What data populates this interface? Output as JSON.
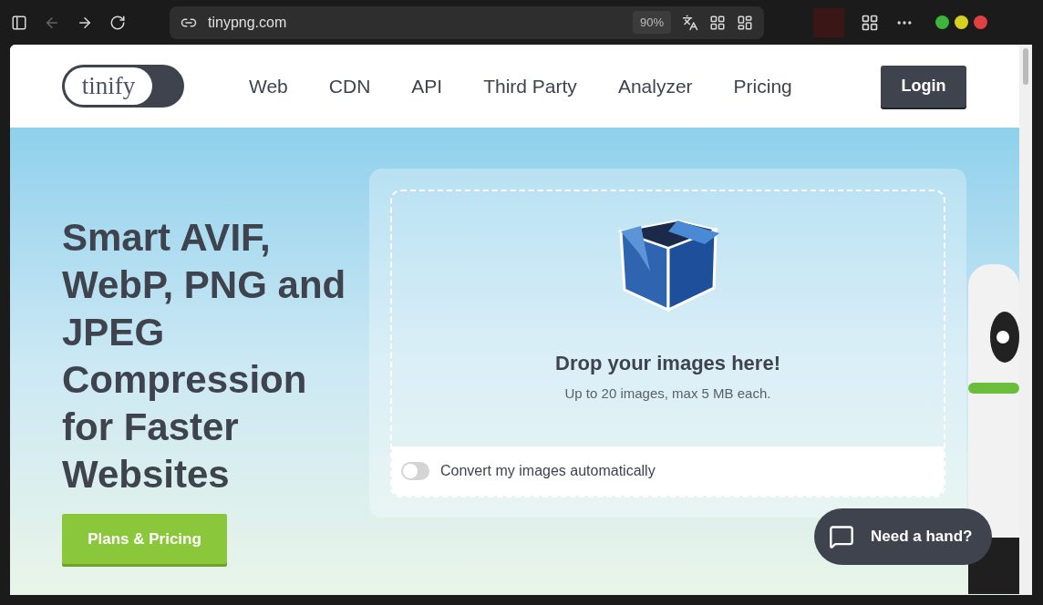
{
  "browser": {
    "url": "tinypng.com",
    "zoom": "90%"
  },
  "nav": {
    "logo": "tinify",
    "links": [
      {
        "label": "Web"
      },
      {
        "label": "CDN"
      },
      {
        "label": "API"
      },
      {
        "label": "Third Party"
      },
      {
        "label": "Analyzer"
      },
      {
        "label": "Pricing"
      }
    ],
    "login": "Login"
  },
  "hero": {
    "title": "Smart AVIF, WebP, PNG and JPEG Compression for Faster Websites",
    "button": "Plans & Pricing"
  },
  "dropzone": {
    "title": "Drop your images here!",
    "subtitle": "Up to 20 images, max 5 MB each.",
    "toggle": {
      "label": "Convert my images automatically",
      "on": false
    }
  },
  "help": {
    "label": "Need a hand?"
  }
}
